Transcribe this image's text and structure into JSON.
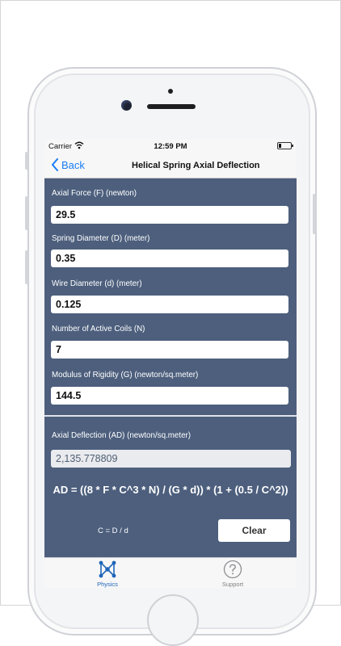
{
  "status": {
    "carrier": "Carrier",
    "time": "12:59 PM"
  },
  "nav": {
    "back_label": "Back",
    "title": "Helical Spring Axial Deflection"
  },
  "inputs": [
    {
      "label": "Axial Force (F) (newton)",
      "value": "29.5"
    },
    {
      "label": "Spring Diameter (D) (meter)",
      "value": "0.35"
    },
    {
      "label": "Wire Diameter (d) (meter)",
      "value": "0.125"
    },
    {
      "label": "Number of Active Coils (N)",
      "value": "7"
    },
    {
      "label": "Modulus of Rigidity (G) (newton/sq.meter)",
      "value": "144.5"
    }
  ],
  "result": {
    "label": "Axial Deflection (AD) (newton/sq.meter)",
    "value": "2,135.778809"
  },
  "formula": "AD = ((8 * F * C^3 * N) / (G * d)) * (1 + (0.5 / C^2))",
  "c_note": "C = D / d",
  "clear_label": "Clear",
  "tabs": [
    {
      "label": "Physics",
      "icon": "physics-icon",
      "active": true
    },
    {
      "label": "Support",
      "icon": "question-icon",
      "active": false
    }
  ],
  "colors": {
    "screen_bg": "#4d5f7d",
    "accent": "#1a7cf5",
    "tab_active": "#1f66b9"
  }
}
